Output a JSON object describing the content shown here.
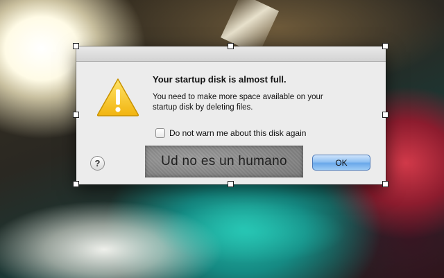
{
  "dialog": {
    "icon": "warning-triangle-icon",
    "title": "Your startup disk is almost full.",
    "message_line1": "You need to make more space available on your",
    "message_line2": "startup disk by deleting files.",
    "checkbox_label": "Do not warn me about this disk again",
    "checkbox_checked": false,
    "help_label": "?",
    "ok_label": "OK"
  },
  "overlay": {
    "captcha_text": "Ud no es un humano"
  },
  "colors": {
    "dialog_background": "#ececec",
    "ok_button": "#6aa8ea",
    "warning_yellow": "#f6c417"
  }
}
